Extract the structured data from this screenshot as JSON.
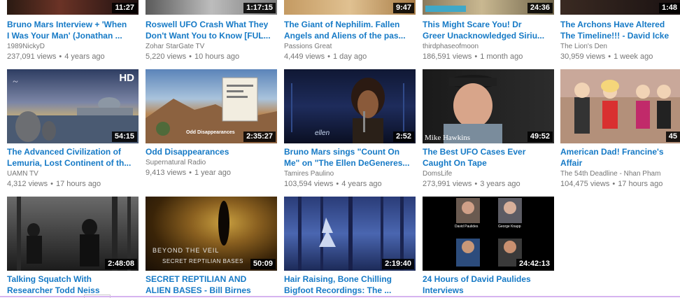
{
  "rows": [
    {
      "cards": [
        {
          "duration": "11:27",
          "title1": "Bruno Mars Interview + 'When",
          "title2": "I Was Your Man' (Jonathan ...",
          "channel": "1989NickyD",
          "views": "237,091 views",
          "age": "4 years ago",
          "thumb": "black"
        },
        {
          "duration": "1:17:15",
          "title1": "Roswell UFO Crash What They",
          "title2": "Don't Want You to Know [FUL...",
          "channel": "Zohar StarGate TV",
          "views": "5,220 views",
          "age": "10 hours ago",
          "thumb": "grey"
        },
        {
          "duration": "9:47",
          "title1": "The Giant of Nephilim. Fallen",
          "title2": "Angels and Aliens of the pas...",
          "channel": "Passions Great",
          "views": "4,449 views",
          "age": "1 day ago",
          "thumb": "sand"
        },
        {
          "duration": "24:36",
          "title1": "This Might Scare You! Dr",
          "title2": "Greer Unacknowledged Siriu...",
          "channel": "thirdphaseofmoon",
          "views": "186,591 views",
          "age": "1 month ago",
          "thumb": "tan"
        },
        {
          "duration": "1:48",
          "title1": "The Archons Have Altered",
          "title2": "The Timeline!!! - David Icke",
          "channel": "The Lion's Den",
          "views": "30,959 views",
          "age": "1 week ago",
          "thumb": "dark"
        }
      ]
    },
    {
      "cards": [
        {
          "duration": "54:15",
          "badge": "HD",
          "title1": "The Advanced Civilization of",
          "title2": "Lemuria, Lost Continent of th...",
          "channel": "UAMN TV",
          "views": "4,312 views",
          "age": "17 hours ago",
          "thumb": "lemuria"
        },
        {
          "duration": "2:35:27",
          "overlay": "Odd Disappearances",
          "title1": "Odd Disappearances",
          "title2": "",
          "channel": "Supernatural Radio",
          "views": "9,413 views",
          "age": "1 year ago",
          "thumb": "desert"
        },
        {
          "duration": "2:52",
          "overlay": "ellen",
          "title1": "Bruno Mars sings \"Count On",
          "title2": "Me\" on \"The Ellen DeGeneres...",
          "channel": "Tamires Paulino",
          "views": "103,594 views",
          "age": "4 years ago",
          "thumb": "stage"
        },
        {
          "duration": "49:52",
          "overlay": "Mike Hawkins",
          "title1": "The Best UFO Cases Ever",
          "title2": "Caught On Tape",
          "channel": "DomsLife",
          "views": "273,991 views",
          "age": "3 years ago",
          "thumb": "portrait"
        },
        {
          "duration": "45",
          "title1": "American Dad! Francine's",
          "title2": "Affair",
          "channel": "The 54th Deadline - Nhan Pham",
          "views": "104,475 views",
          "age": "17 hours ago",
          "thumb": "cartoon"
        }
      ]
    },
    {
      "cards": [
        {
          "duration": "2:48:08",
          "title1": "Talking Squatch With",
          "title2": "Researcher Todd Neiss",
          "thumb": "forest"
        },
        {
          "duration": "50:09",
          "overlay": "BEYOND THE VEIL",
          "overlay2": "SECRET REPTILIAN BASES",
          "title1": "SECRET REPTILIAN AND",
          "title2": "ALIEN BASES - Bill Birnes",
          "thumb": "reptile"
        },
        {
          "duration": "2:19:40",
          "title1": "Hair Raising, Bone Chilling",
          "title2": "Bigfoot Recordings: The ...",
          "thumb": "blue"
        },
        {
          "duration": "24:42:13",
          "names": [
            "David Paulides",
            "George Knapp"
          ],
          "title1": "24 Hours of David Paulides",
          "title2": "Interviews",
          "thumb": "collage"
        }
      ]
    }
  ]
}
